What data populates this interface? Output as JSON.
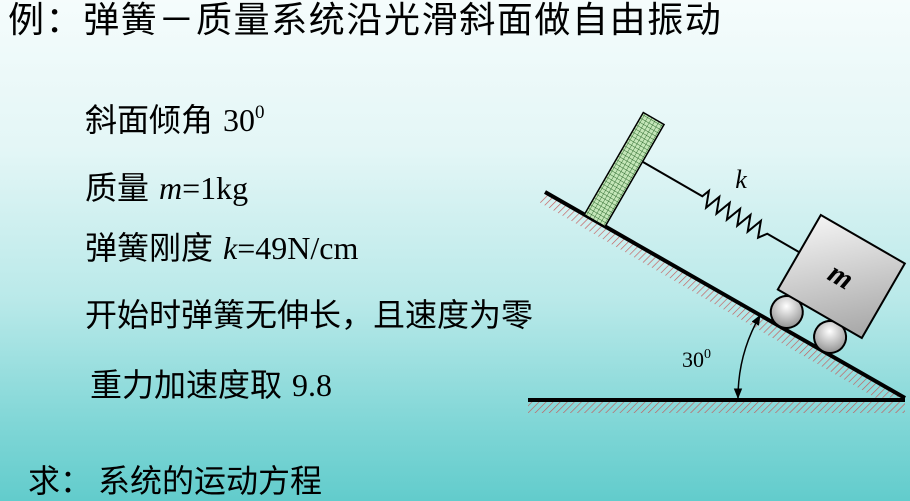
{
  "title": "例：弹簧－质量系统沿光滑斜面做自由振动",
  "given": {
    "incline_angle": {
      "label": "斜面倾角",
      "value": "30",
      "sup": "0"
    },
    "mass": {
      "label": "质量",
      "symbol": "m",
      "value": "=1kg"
    },
    "stiffness": {
      "label": "弹簧刚度",
      "symbol": "k",
      "value": "=49N/cm"
    },
    "initial": "开始时弹簧无伸长，且速度为零",
    "gravity": {
      "label": "重力加速度取",
      "value": "9.8"
    }
  },
  "find": {
    "label": "求：",
    "text": "系统的运动方程"
  },
  "diagram": {
    "spring_label": "k",
    "mass_label": "m",
    "angle_value": "30",
    "angle_sup": "0"
  },
  "colors": {
    "bg_top": "#f5fcfc",
    "bg_bottom": "#62cccc",
    "hatch": "#c45a5a",
    "post_grid": "#2f6b2f",
    "post_fill": "#c4e6b8"
  }
}
